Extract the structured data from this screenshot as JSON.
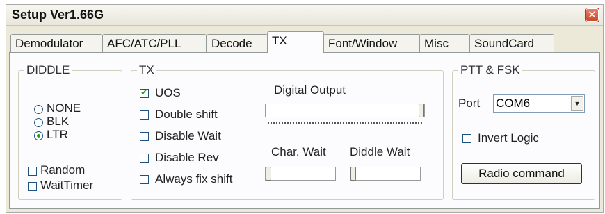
{
  "window": {
    "title": "Setup Ver1.66G",
    "close_glyph": "✕"
  },
  "tabs": [
    {
      "label": "Demodulator",
      "active": false
    },
    {
      "label": "AFC/ATC/PLL",
      "active": false
    },
    {
      "label": "Decode",
      "active": false
    },
    {
      "label": "TX",
      "active": true
    },
    {
      "label": "Font/Window",
      "active": false
    },
    {
      "label": "Misc",
      "active": false
    },
    {
      "label": "SoundCard",
      "active": false
    }
  ],
  "diddle": {
    "legend": "DIDDLE",
    "options": [
      {
        "label": "NONE",
        "checked": false
      },
      {
        "label": "BLK",
        "checked": false
      },
      {
        "label": "LTR",
        "checked": true
      }
    ],
    "random": {
      "label": "Random",
      "checked": false
    },
    "waittimer": {
      "label": "WaitTimer",
      "checked": false
    }
  },
  "tx": {
    "legend": "TX",
    "checkboxes": [
      {
        "label": "UOS",
        "checked": true
      },
      {
        "label": "Double shift",
        "checked": false
      },
      {
        "label": "Disable Wait",
        "checked": false
      },
      {
        "label": "Disable Rev",
        "checked": false
      },
      {
        "label": "Always fix shift",
        "checked": false
      }
    ],
    "digital_output": {
      "label": "Digital Output",
      "level": 1.0
    },
    "char_wait": {
      "label": "Char. Wait",
      "level": 0.0
    },
    "diddle_wait": {
      "label": "Diddle Wait",
      "level": 0.0
    }
  },
  "ptt": {
    "legend": "PTT & FSK",
    "port_label": "Port",
    "port_value": "COM6",
    "invert": {
      "label": "Invert Logic",
      "checked": false
    },
    "radio_button": "Radio command"
  },
  "colors": {
    "check": "#21a121",
    "close": "#c94a2a",
    "tab_border": "#919b9c"
  }
}
